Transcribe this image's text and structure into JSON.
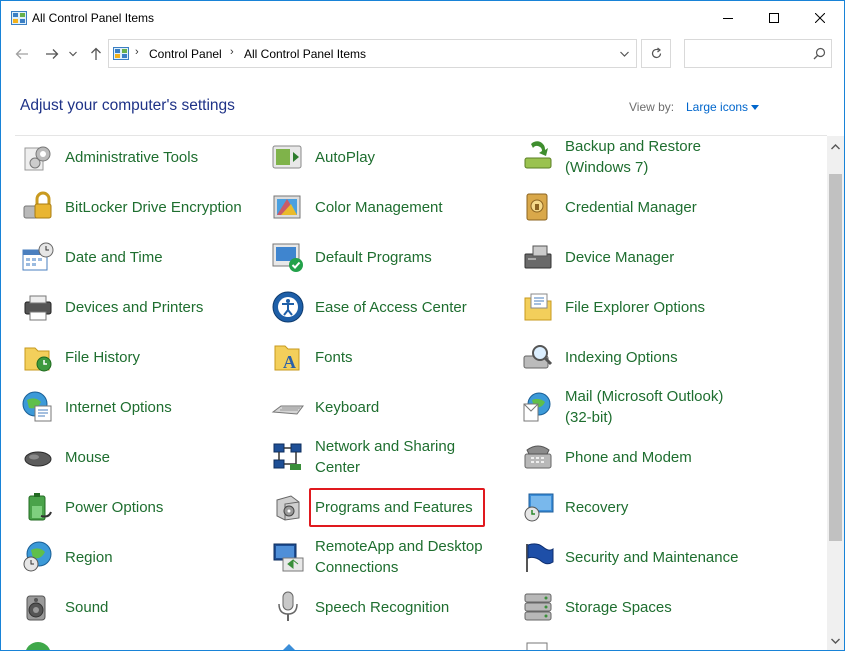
{
  "window": {
    "title": "All Control Panel Items"
  },
  "nav": {
    "breadcrumbs": [
      "Control Panel",
      "All Control Panel Items"
    ],
    "search_placeholder": ""
  },
  "header": {
    "heading": "Adjust your computer's settings",
    "view_by_label": "View by:",
    "view_by_value": "Large icons"
  },
  "items": [
    {
      "label": "Administrative Tools",
      "icon": "admin-tools-icon"
    },
    {
      "label": "AutoPlay",
      "icon": "autoplay-icon"
    },
    {
      "label": "Backup and Restore (Windows 7)",
      "icon": "backup-restore-icon"
    },
    {
      "label": "BitLocker Drive Encryption",
      "icon": "bitlocker-icon"
    },
    {
      "label": "Color Management",
      "icon": "color-management-icon"
    },
    {
      "label": "Credential Manager",
      "icon": "credential-manager-icon"
    },
    {
      "label": "Date and Time",
      "icon": "date-time-icon"
    },
    {
      "label": "Default Programs",
      "icon": "default-programs-icon"
    },
    {
      "label": "Device Manager",
      "icon": "device-manager-icon"
    },
    {
      "label": "Devices and Printers",
      "icon": "devices-printers-icon"
    },
    {
      "label": "Ease of Access Center",
      "icon": "ease-of-access-icon"
    },
    {
      "label": "File Explorer Options",
      "icon": "file-explorer-options-icon"
    },
    {
      "label": "File History",
      "icon": "file-history-icon"
    },
    {
      "label": "Fonts",
      "icon": "fonts-icon"
    },
    {
      "label": "Indexing Options",
      "icon": "indexing-options-icon"
    },
    {
      "label": "Internet Options",
      "icon": "internet-options-icon"
    },
    {
      "label": "Keyboard",
      "icon": "keyboard-icon"
    },
    {
      "label": "Mail (Microsoft Outlook) (32-bit)",
      "icon": "mail-icon"
    },
    {
      "label": "Mouse",
      "icon": "mouse-icon"
    },
    {
      "label": "Network and Sharing Center",
      "icon": "network-sharing-icon"
    },
    {
      "label": "Phone and Modem",
      "icon": "phone-modem-icon"
    },
    {
      "label": "Power Options",
      "icon": "power-options-icon"
    },
    {
      "label": "Programs and Features",
      "icon": "programs-features-icon"
    },
    {
      "label": "Recovery",
      "icon": "recovery-icon"
    },
    {
      "label": "Region",
      "icon": "region-icon"
    },
    {
      "label": "RemoteApp and Desktop Connections",
      "icon": "remoteapp-icon"
    },
    {
      "label": "Security and Maintenance",
      "icon": "security-maintenance-icon"
    },
    {
      "label": "Sound",
      "icon": "sound-icon"
    },
    {
      "label": "Speech Recognition",
      "icon": "speech-recognition-icon"
    },
    {
      "label": "Storage Spaces",
      "icon": "storage-spaces-icon"
    }
  ],
  "colors": {
    "item_text": "#1e6e2f",
    "heading": "#1e3287",
    "link": "#0066cc",
    "highlight": "#e0191e"
  }
}
